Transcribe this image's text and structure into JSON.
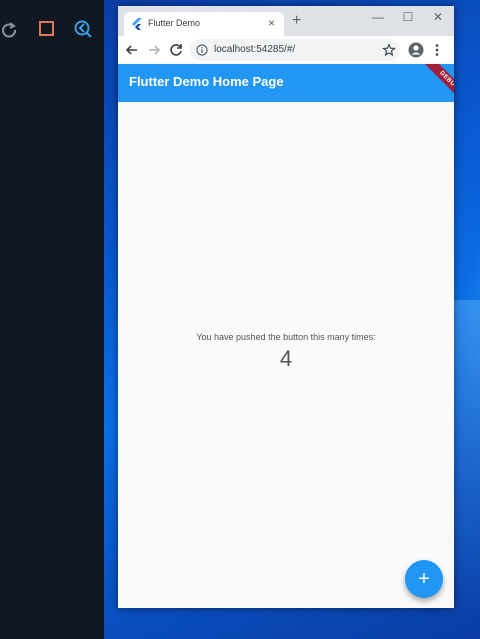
{
  "ide": {
    "icons": [
      "restart-icon",
      "stop-icon",
      "flutter-inspector-icon"
    ],
    "colors": {
      "restart": "#8a949e",
      "stop": "#e0785a",
      "inspector": "#3aa0e6"
    }
  },
  "browser": {
    "tab_title": "Flutter Demo",
    "tab_close": "×",
    "new_tab": "+",
    "url": "localhost:54285/#/",
    "window_controls": {
      "minimize": "—",
      "maximize": "☐",
      "close": "✕"
    }
  },
  "app": {
    "title": "Flutter Demo Home Page",
    "debug_banner": "DEBUG",
    "counter_label": "You have pushed the button this many times:",
    "counter_value": "4",
    "fab_label": "+",
    "colors": {
      "primary": "#2196f3",
      "debug": "#a21f39"
    }
  }
}
